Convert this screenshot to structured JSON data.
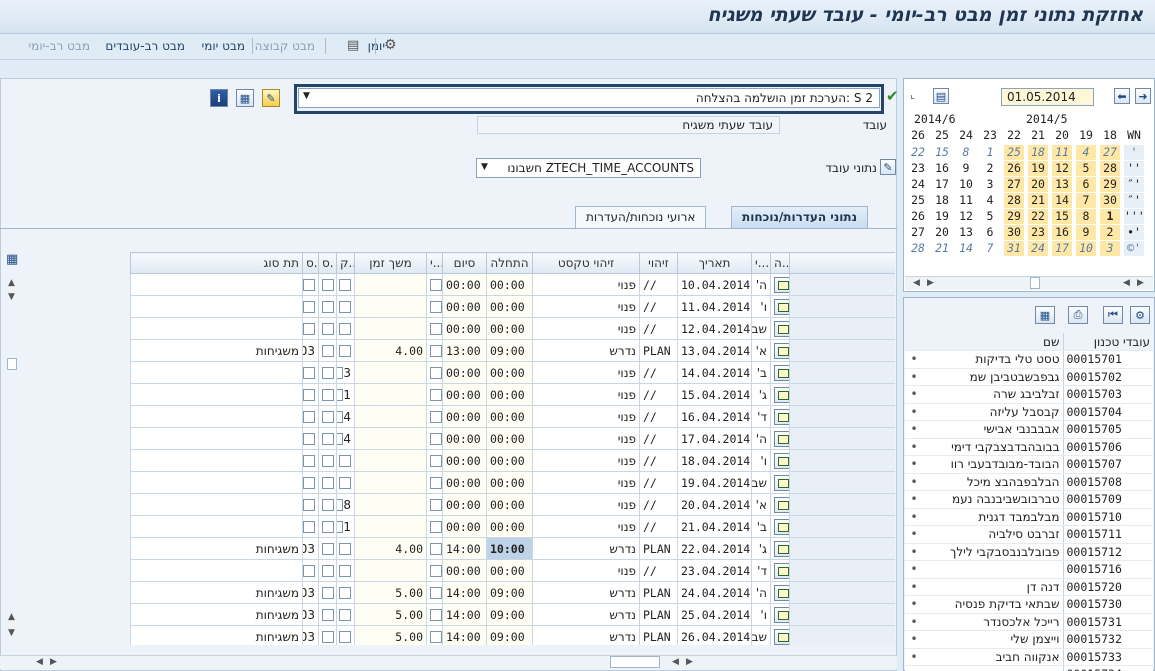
{
  "window": {
    "title": "אחזקת נתוני זמן מבט רב-יומי - עובד שעתי משגיח"
  },
  "menu": {
    "items": [
      {
        "label": "מבט רב-יומי",
        "disabled": true
      },
      {
        "label": "מבט רב-עובדים",
        "disabled": false
      },
      {
        "label": "מבט יומי",
        "disabled": false
      },
      {
        "label": "מבט קבוצה",
        "disabled": true
      },
      {
        "label": "יומן",
        "disabled": false
      }
    ]
  },
  "header": {
    "message_select": "S 2 :הערכת זמן הושלמה בהצלחה",
    "employee_label": "עובד",
    "employee_value": "עובד שעתי משגיח",
    "employee_data_label": "נתוני עובד",
    "account_select": "ZTECH_TIME_ACCOUNTS חשבונו"
  },
  "tabs": [
    {
      "label": "נתוני העדרות/נוכחות",
      "active": true
    },
    {
      "label": "ארועי נוכחות/העדרות",
      "active": false
    }
  ],
  "table": {
    "columns": [
      "ה...",
      "י...",
      "תאריך",
      "זיהוי",
      "זיהוי טקסט",
      "התחלה",
      "סיום",
      "י...",
      "משך זמן",
      "ק..",
      "ס.",
      "ס.",
      "תת סוג"
    ],
    "rows": [
      {
        "day": "ה'",
        "date": "10.04.2014",
        "id": "//",
        "text": "פנוי",
        "start": "00:00",
        "end": "00:00",
        "dur": "",
        "k": "",
        "sub": ""
      },
      {
        "day": "ו'",
        "date": "11.04.2014",
        "id": "//",
        "text": "פנוי",
        "start": "00:00",
        "end": "00:00",
        "dur": "",
        "k": "",
        "sub": ""
      },
      {
        "day": "שב",
        "date": "12.04.2014",
        "id": "//",
        "text": "פנוי",
        "start": "00:00",
        "end": "00:00",
        "dur": "",
        "k": "",
        "sub": ""
      },
      {
        "day": "א'",
        "date": "13.04.2014",
        "id": "PLAN",
        "text": "נדרש",
        "start": "09:00",
        "end": "13:00",
        "dur": "4.00",
        "k": "",
        "code": "03",
        "sub": "משגיחות"
      },
      {
        "day": "ב'",
        "date": "14.04.2014",
        "id": "//",
        "text": "פנוי",
        "start": "00:00",
        "end": "00:00",
        "dur": "",
        "k": "3",
        "sub": ""
      },
      {
        "day": "ג'",
        "date": "15.04.2014",
        "id": "//",
        "text": "פנוי",
        "start": "00:00",
        "end": "00:00",
        "dur": "",
        "k": "1",
        "sub": ""
      },
      {
        "day": "ד'",
        "date": "16.04.2014",
        "id": "//",
        "text": "פנוי",
        "start": "00:00",
        "end": "00:00",
        "dur": "",
        "k": "4",
        "sub": ""
      },
      {
        "day": "ה'",
        "date": "17.04.2014",
        "id": "//",
        "text": "פנוי",
        "start": "00:00",
        "end": "00:00",
        "dur": "",
        "k": "4",
        "sub": ""
      },
      {
        "day": "ו'",
        "date": "18.04.2014",
        "id": "//",
        "text": "פנוי",
        "start": "00:00",
        "end": "00:00",
        "dur": "",
        "k": "",
        "sub": ""
      },
      {
        "day": "שב",
        "date": "19.04.2014",
        "id": "//",
        "text": "פנוי",
        "start": "00:00",
        "end": "00:00",
        "dur": "",
        "k": "",
        "sub": ""
      },
      {
        "day": "א'",
        "date": "20.04.2014",
        "id": "//",
        "text": "פנוי",
        "start": "00:00",
        "end": "00:00",
        "dur": "",
        "k": "8",
        "sub": ""
      },
      {
        "day": "ב'",
        "date": "21.04.2014",
        "id": "//",
        "text": "פנוי",
        "start": "00:00",
        "end": "00:00",
        "dur": "",
        "k": "1",
        "sub": ""
      },
      {
        "day": "ג'",
        "date": "22.04.2014",
        "id": "PLAN",
        "text": "נדרש",
        "start": "10:00",
        "end": "14:00",
        "dur": "4.00",
        "k": "",
        "code": "03",
        "sub": "משגיחות",
        "hl": true
      },
      {
        "day": "ד'",
        "date": "23.04.2014",
        "id": "//",
        "text": "פנוי",
        "start": "00:00",
        "end": "00:00",
        "dur": "",
        "k": "",
        "sub": ""
      },
      {
        "day": "ה'",
        "date": "24.04.2014",
        "id": "PLAN",
        "text": "נדרש",
        "start": "09:00",
        "end": "14:00",
        "dur": "5.00",
        "k": "",
        "code": "03",
        "sub": "משגיחות"
      },
      {
        "day": "ו'",
        "date": "25.04.2014",
        "id": "PLAN",
        "text": "נדרש",
        "start": "09:00",
        "end": "14:00",
        "dur": "5.00",
        "k": "",
        "code": "03",
        "sub": "משגיחות"
      },
      {
        "day": "שב",
        "date": "26.04.2014",
        "id": "PLAN",
        "text": "נדרש",
        "start": "09:00",
        "end": "14:00",
        "dur": "5.00",
        "k": "",
        "code": "03",
        "sub": "משגיחות"
      }
    ]
  },
  "calendar": {
    "date": "01.05.2014",
    "months": [
      "2014/6",
      "2014/5"
    ],
    "week_header": [
      "26",
      "25",
      "24",
      "23",
      "22",
      "21",
      "20",
      "19",
      "18",
      "WN"
    ],
    "rows": [
      {
        "cells": [
          "22",
          "15",
          "8",
          "1",
          "25",
          "18",
          "11",
          "4",
          "27",
          "'"
        ],
        "dim": true
      },
      {
        "cells": [
          "23",
          "16",
          "9",
          "2",
          "26",
          "19",
          "12",
          "5",
          "28",
          "''"
        ],
        "dim": false
      },
      {
        "cells": [
          "24",
          "17",
          "10",
          "3",
          "27",
          "20",
          "13",
          "6",
          "29",
          "″'"
        ],
        "dim": false
      },
      {
        "cells": [
          "25",
          "18",
          "11",
          "4",
          "28",
          "21",
          "14",
          "7",
          "30",
          "″'"
        ],
        "dim": false
      },
      {
        "cells": [
          "26",
          "19",
          "12",
          "5",
          "29",
          "22",
          "15",
          "8",
          "1",
          "'''"
        ],
        "dim": false
      },
      {
        "cells": [
          "27",
          "20",
          "13",
          "6",
          "30",
          "23",
          "16",
          "9",
          "2",
          "•'"
        ],
        "dim": false
      },
      {
        "cells": [
          "28",
          "21",
          "14",
          "7",
          "31",
          "24",
          "17",
          "10",
          "3",
          "©'"
        ],
        "dim": true
      }
    ]
  },
  "employees": {
    "col_name": "שם",
    "col_id": "עובדי טכנון",
    "rows": [
      {
        "id": "00015701",
        "name": "טסט טלי בדיקות"
      },
      {
        "id": "00015702",
        "name": "גבפבשבטביבן שמ"
      },
      {
        "id": "00015703",
        "name": "זבלביבג שרה"
      },
      {
        "id": "00015704",
        "name": "קבסבל עליזה"
      },
      {
        "id": "00015705",
        "name": "אבבבנבי אבישי"
      },
      {
        "id": "00015706",
        "name": "בבובהבדבצבקבי דימי"
      },
      {
        "id": "00015707",
        "name": "הבובד-מבובדבעבי רוו"
      },
      {
        "id": "00015708",
        "name": "הבלבפבהבצ מיכל"
      },
      {
        "id": "00015709",
        "name": "טברבובשביבנבה נעמ"
      },
      {
        "id": "00015710",
        "name": "מבלבמבד דגנית"
      },
      {
        "id": "00015711",
        "name": "זברבט סילביה"
      },
      {
        "id": "00015712",
        "name": "פבובלבנבסבקבי לילך"
      },
      {
        "id": "00015716",
        "name": ""
      },
      {
        "id": "00015720",
        "name": "דנה דן"
      },
      {
        "id": "00015730",
        "name": "שבתאי בדיקת פנסיה"
      },
      {
        "id": "00015731",
        "name": "רייכל אלכסנדר"
      },
      {
        "id": "00015732",
        "name": "וייצמן שלי"
      },
      {
        "id": "00015733",
        "name": "אנקווה חביב"
      },
      {
        "id": "00015734",
        "name": ""
      }
    ]
  },
  "colors": {
    "accent": "#24466a",
    "title": "#1f3550",
    "calendar_highlight": "#ffe7a6"
  }
}
